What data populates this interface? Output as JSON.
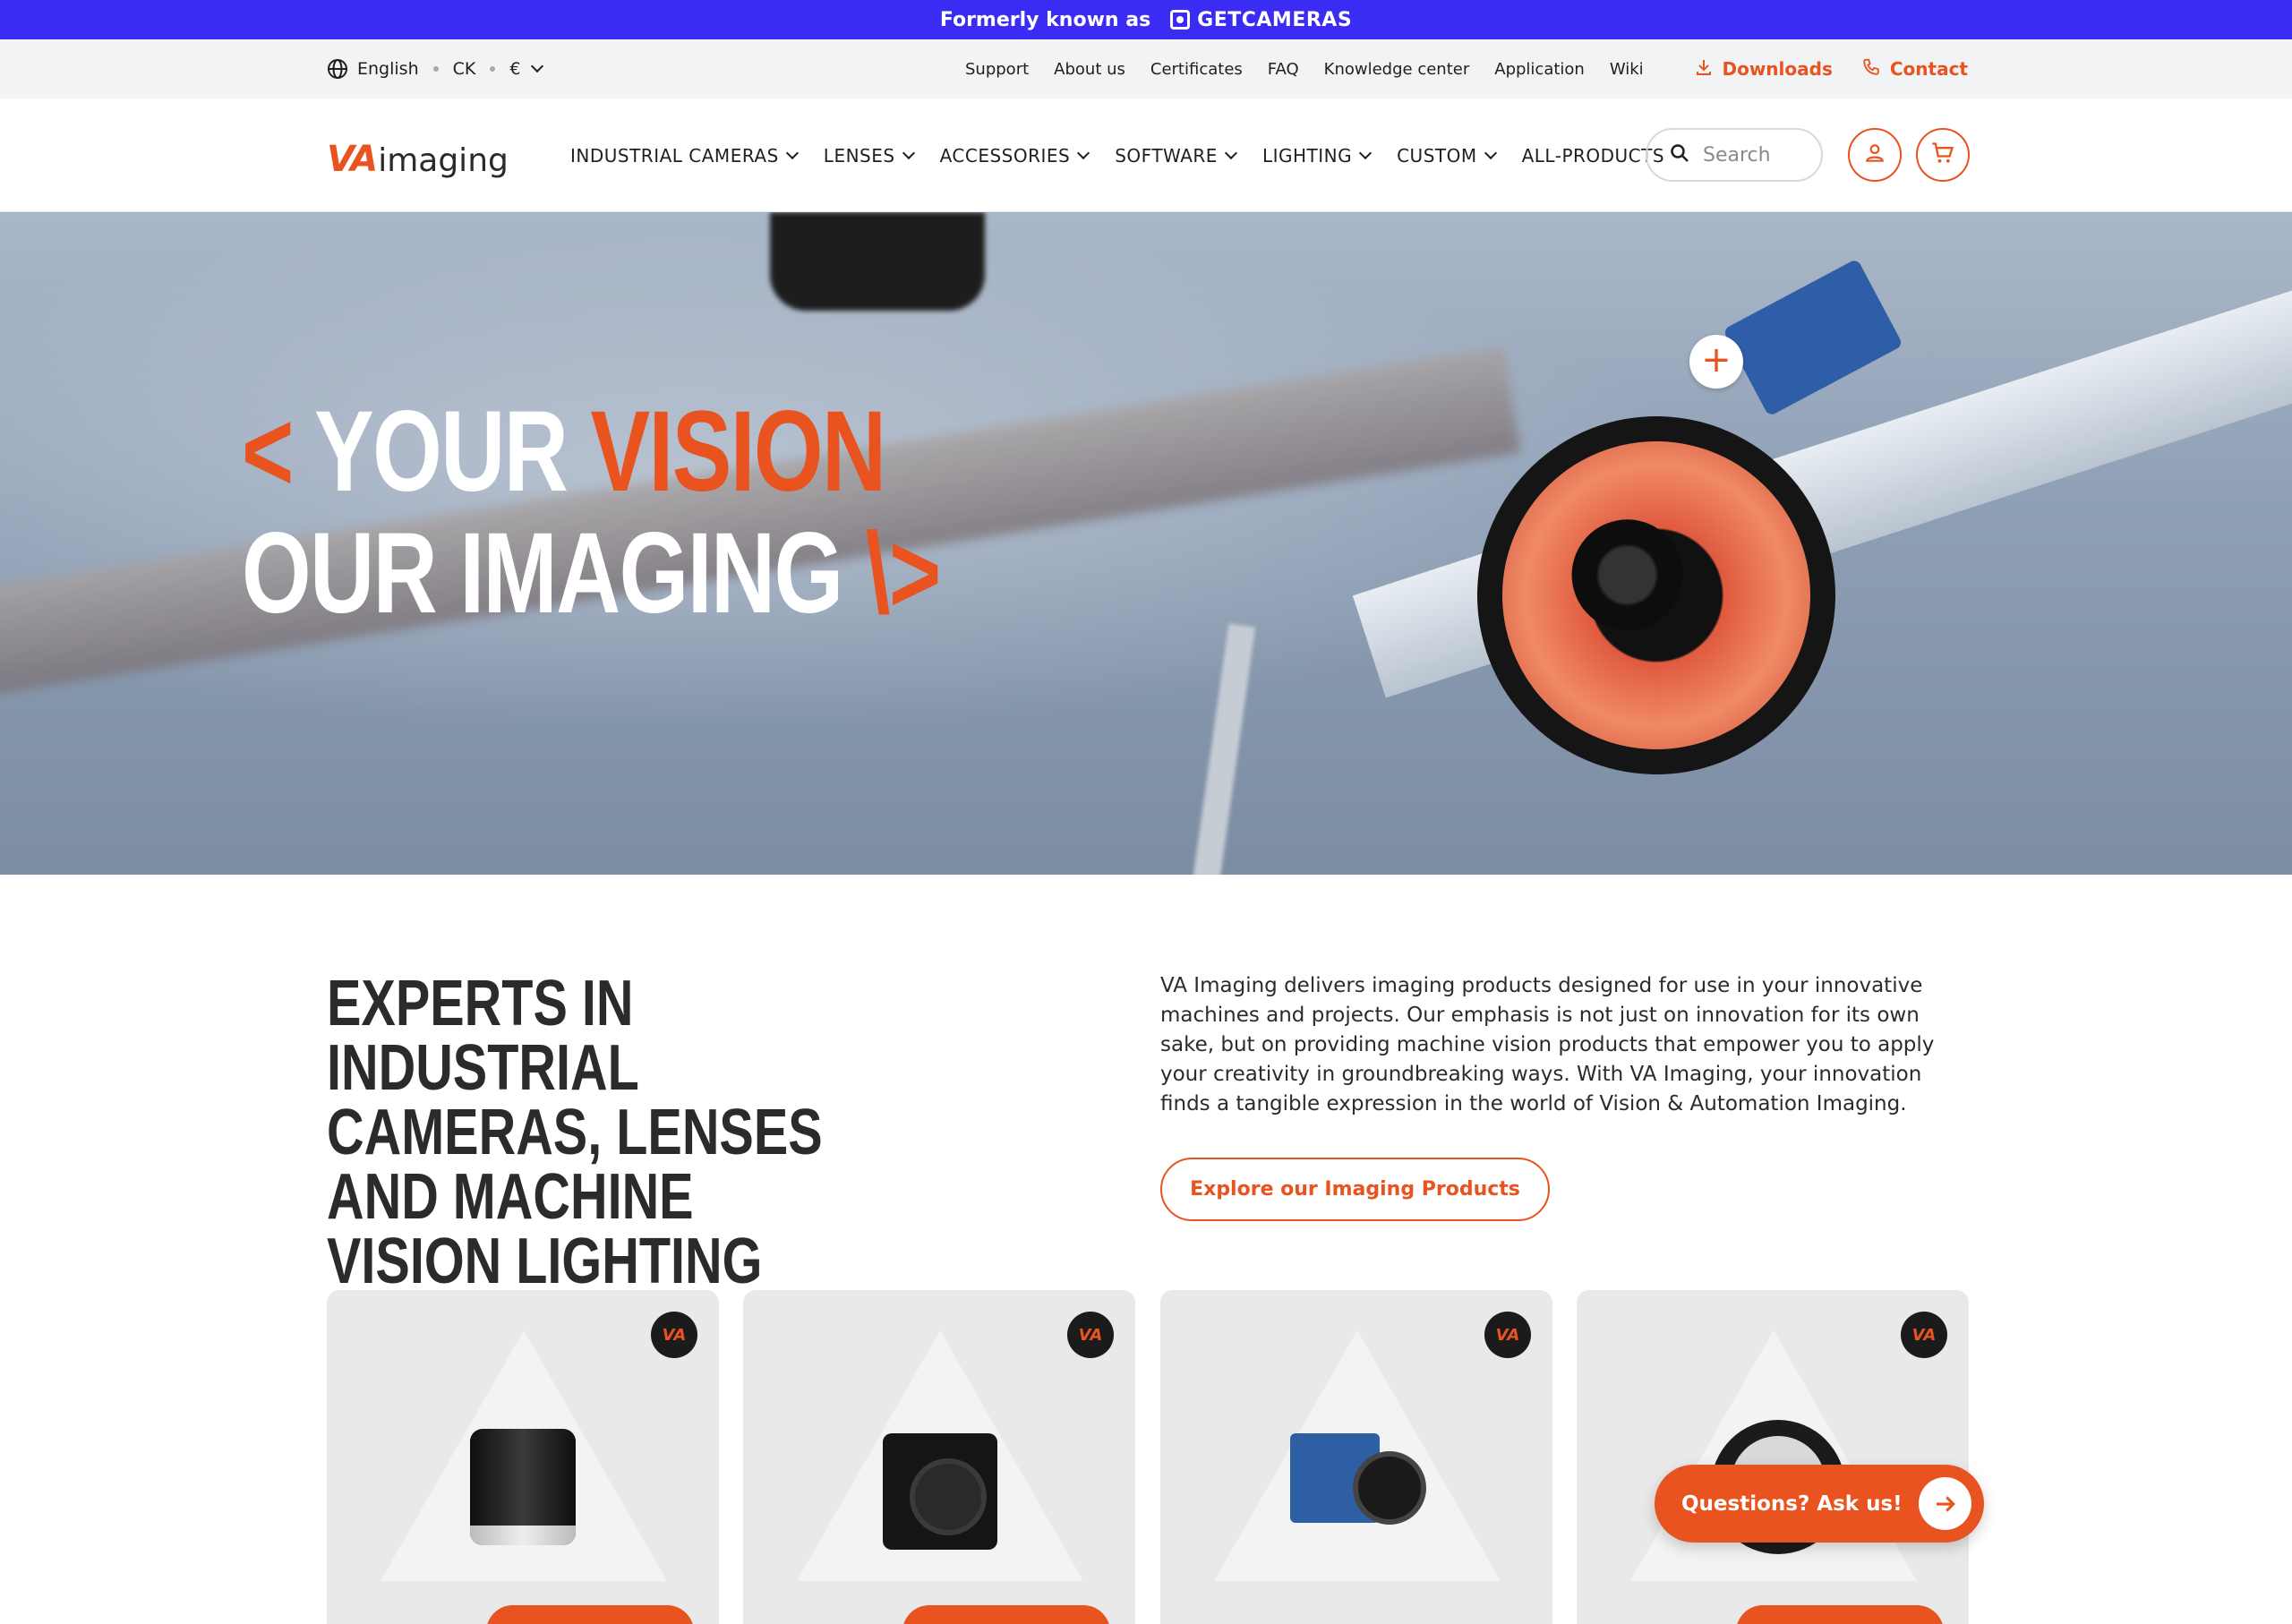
{
  "announcement": {
    "prefix": "Formerly known as",
    "brand": "GETCAMERAS"
  },
  "utility": {
    "language": "English",
    "country": "CK",
    "currency": "€",
    "links": [
      "Support",
      "About us",
      "Certificates",
      "FAQ",
      "Knowledge center",
      "Application",
      "Wiki"
    ],
    "downloads": "Downloads",
    "contact": "Contact"
  },
  "header": {
    "logo_va": "VA",
    "logo_imaging": "imaging",
    "nav": [
      {
        "label": "INDUSTRIAL CAMERAS"
      },
      {
        "label": "LENSES"
      },
      {
        "label": "ACCESSORIES"
      },
      {
        "label": "SOFTWARE"
      },
      {
        "label": "LIGHTING"
      },
      {
        "label": "CUSTOM"
      },
      {
        "label": "ALL-PRODUCTS"
      }
    ],
    "search_placeholder": "Search"
  },
  "hero": {
    "line1_open": "< ",
    "line1_word": "YOUR ",
    "line1_accent": "VISION",
    "line2_word": "OUR IMAGING ",
    "line2_close": "\\>",
    "plus": "+"
  },
  "intro": {
    "heading": "EXPERTS IN INDUSTRIAL CAMERAS, LENSES AND MACHINE VISION LIGHTING",
    "body": "VA Imaging delivers imaging products designed for use in your innovative machines and projects. Our emphasis is not just on innovation for its own sake, but on providing machine vision products that empower you to apply your creativity in groundbreaking ways. With VA Imaging, your innovation finds a tangible expression in the world of Vision & Automation Imaging.",
    "cta": "Explore our Imaging Products"
  },
  "cards": [
    {
      "badge": "VA",
      "product": "lens-icon"
    },
    {
      "badge": "VA",
      "product": "camera-icon"
    },
    {
      "badge": "VA",
      "product": "camera-icon"
    },
    {
      "badge": "VA",
      "product": "ring-light-icon"
    }
  ],
  "ask": {
    "label": "Questions? Ask us!"
  },
  "colors": {
    "accent": "#e8531f",
    "announce_bg": "#3a2cf2"
  }
}
